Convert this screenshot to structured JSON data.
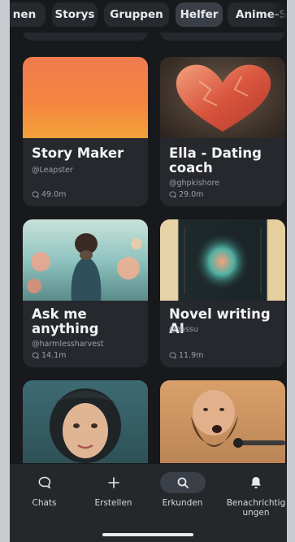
{
  "chips": [
    {
      "label": "nen",
      "active": false
    },
    {
      "label": "Storys",
      "active": false
    },
    {
      "label": "Gruppen",
      "active": false
    },
    {
      "label": "Helfer",
      "active": true
    },
    {
      "label": "Anime-Sp",
      "active": false
    }
  ],
  "cards": [
    {
      "title": "Story Maker",
      "author": "@Leapster",
      "count": "49.0m",
      "thumb": "gradient-orange"
    },
    {
      "title": "Ella - Dating coach",
      "author": "@ghpkishore",
      "count": "29.0m",
      "thumb": "heart-painting"
    },
    {
      "title": "Ask me anything",
      "author": "@harmlessharvest",
      "count": "14.1m",
      "thumb": "woman-in-flowers"
    },
    {
      "title": "Novel writing AI",
      "author": "@Yassu",
      "count": "11.9m",
      "thumb": "glowing-book"
    },
    {
      "title": "",
      "author": "",
      "count": "",
      "thumb": "portrait-woman"
    },
    {
      "title": "",
      "author": "",
      "count": "",
      "thumb": "portrait-bearded-man"
    }
  ],
  "nav": [
    {
      "label": "Chats",
      "icon": "chat-bubble-icon",
      "active": false
    },
    {
      "label": "Erstellen",
      "icon": "plus-icon",
      "active": false
    },
    {
      "label": "Erkunden",
      "icon": "search-icon",
      "active": true
    },
    {
      "label": "Benachrichtigungen",
      "icon": "bell-icon",
      "active": false
    }
  ],
  "colors": {
    "background": "#18191c",
    "card": "#26282d",
    "nav": "#25272b",
    "active_pill": "#3a3f48"
  }
}
